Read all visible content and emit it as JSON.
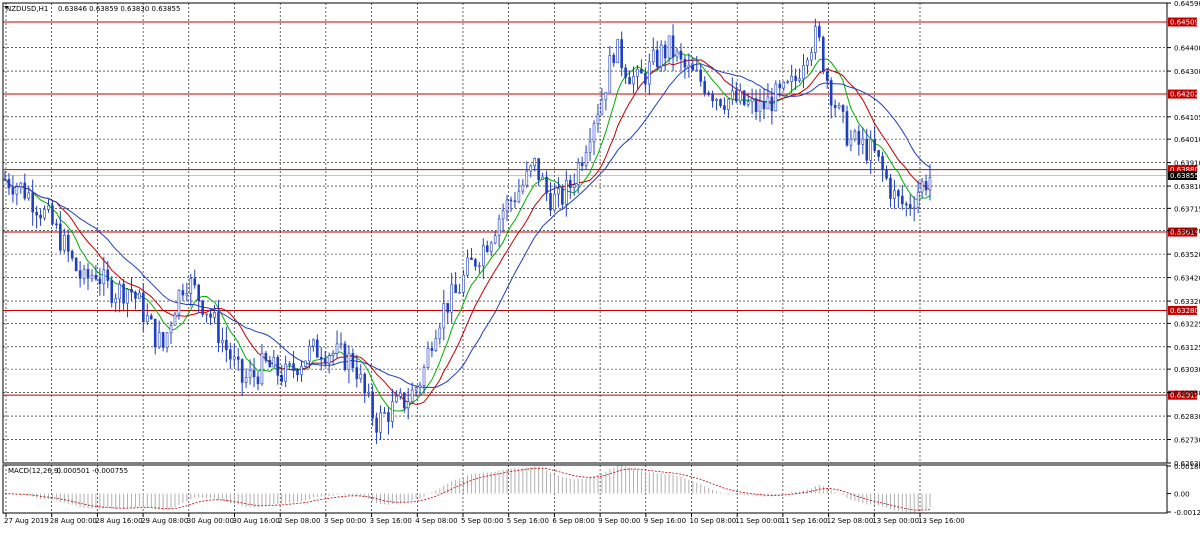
{
  "header": {
    "symbol": "NZDUSD,H1",
    "ohlc": "0.63846 0.63859 0.63830 0.63855"
  },
  "macd": {
    "label": "MACD(12,26,9)",
    "values": "-0.000501 -0.000755",
    "axis": [
      "0.001804",
      "0.00",
      "-0.001206"
    ],
    "range": [
      -0.001206,
      0.001804
    ]
  },
  "price_axis": {
    "labels": [
      "0.64590",
      "0.64400",
      "0.64300",
      "0.64105",
      "0.64010",
      "0.63910",
      "0.63810",
      "0.63715",
      "0.63620",
      "0.63520",
      "0.63420",
      "0.63320",
      "0.63225",
      "0.63125",
      "0.63030",
      "0.62930",
      "0.62830",
      "0.62730",
      "0.62630"
    ],
    "range": [
      0.6263,
      0.6459
    ]
  },
  "levels": [
    {
      "value": 0.64509,
      "label": "0.64509"
    },
    {
      "value": 0.64202,
      "label": "0.64202"
    },
    {
      "value": 0.6388,
      "label": "0.63880"
    },
    {
      "value": 0.63614,
      "label": "0.63614"
    },
    {
      "value": 0.6328,
      "label": "0.63280"
    },
    {
      "value": 0.62919,
      "label": "0.62919"
    }
  ],
  "current_price": {
    "value": 0.63855,
    "label": "0.63855"
  },
  "time_axis": [
    "27 Aug 2019",
    "28 Aug 00:00",
    "28 Aug 16:00",
    "29 Aug 08:00",
    "30 Aug 00:00",
    "30 Aug 16:00",
    "2 Sep 08:00",
    "3 Sep 00:00",
    "3 Sep 16:00",
    "4 Sep 08:00",
    "5 Sep 00:00",
    "5 Sep 16:00",
    "6 Sep 08:00",
    "9 Sep 00:00",
    "9 Sep 16:00",
    "10 Sep 08:00",
    "11 Sep 00:00",
    "11 Sep 16:00",
    "12 Sep 08:00",
    "13 Sep 00:00",
    "13 Sep 16:00"
  ],
  "colors": {
    "candle": "#1f3fbf",
    "level": "#c00000",
    "badge": "#c00000",
    "ma_fast": "#00b000",
    "ma_mid": "#c00000",
    "ma_slow": "#1f3fbf",
    "grid": "#000000",
    "current_badge": "#000000"
  },
  "chart_data": {
    "type": "candlestick",
    "series_anchor_prices": [
      0.6384,
      0.6382,
      0.6378,
      0.6372,
      0.6366,
      0.6358,
      0.6348,
      0.634,
      0.6345,
      0.6338,
      0.6336,
      0.6338,
      0.633,
      0.632,
      0.6312,
      0.633,
      0.6342,
      0.6335,
      0.6328,
      0.6318,
      0.6308,
      0.6298,
      0.63,
      0.6305,
      0.6302,
      0.63,
      0.6306,
      0.631,
      0.6312,
      0.631,
      0.6308,
      0.6306,
      0.629,
      0.628,
      0.6285,
      0.6288,
      0.6292,
      0.63,
      0.632,
      0.633,
      0.6335,
      0.6345,
      0.6352,
      0.636,
      0.637,
      0.6376,
      0.6382,
      0.639,
      0.6378,
      0.6374,
      0.638,
      0.6392,
      0.6408,
      0.642,
      0.644,
      0.6432,
      0.6425,
      0.643,
      0.6437,
      0.644,
      0.6432,
      0.6428,
      0.6425,
      0.642,
      0.6418,
      0.6417,
      0.6415,
      0.6414,
      0.6418,
      0.642,
      0.6425,
      0.644,
      0.6445,
      0.6425,
      0.641,
      0.64,
      0.6398,
      0.6395,
      0.6385,
      0.6375,
      0.6372,
      0.638,
      0.6385
    ]
  }
}
